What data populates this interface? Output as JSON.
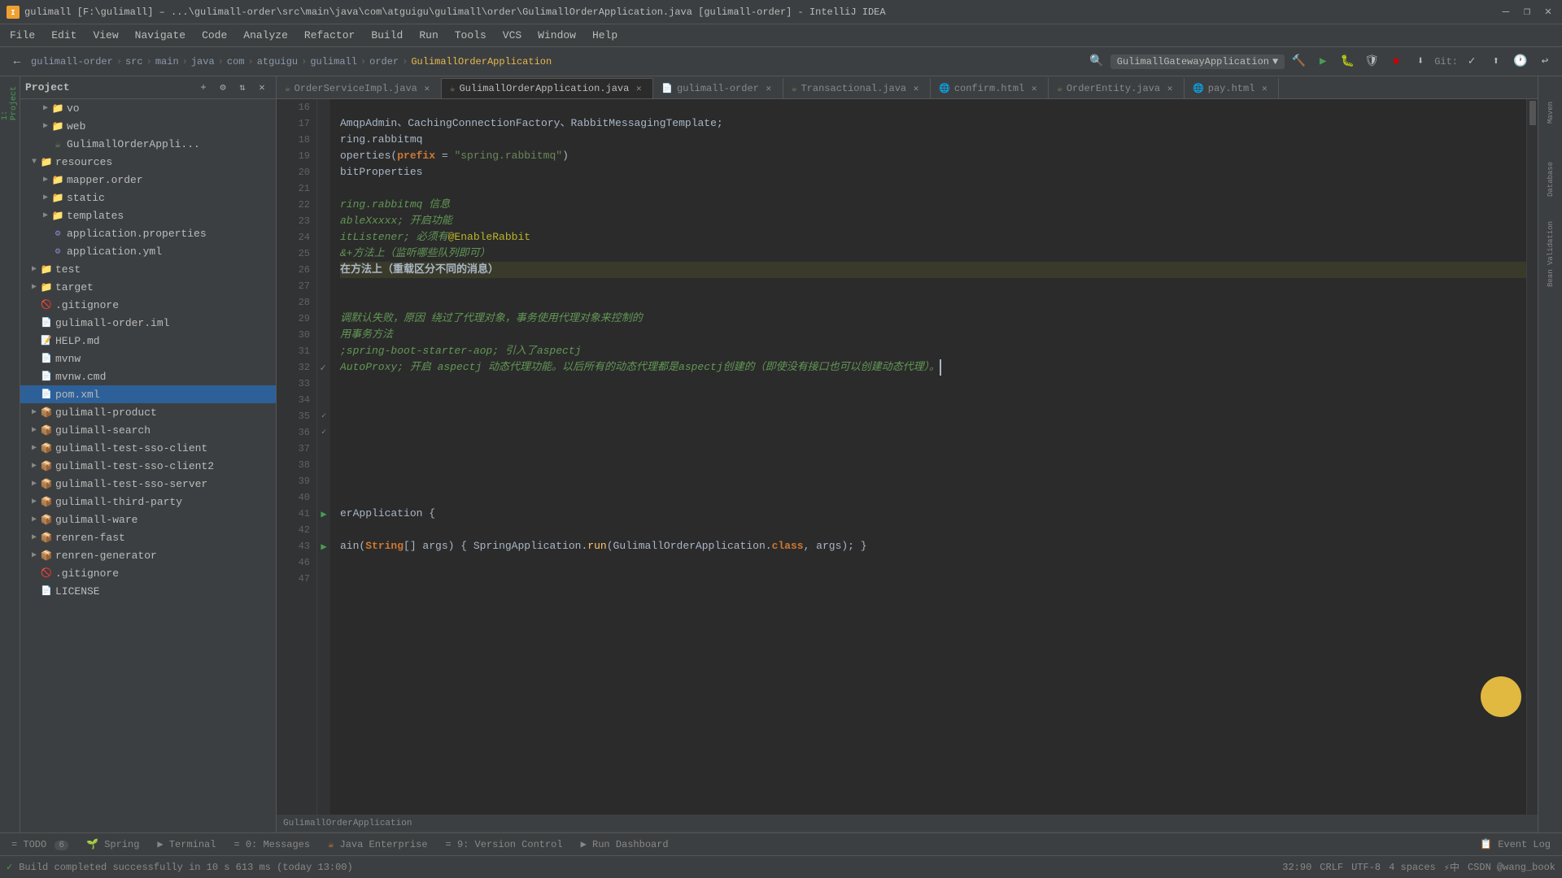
{
  "titleBar": {
    "title": "gulimall [F:\\gulimall] – ...\\gulimall-order\\src\\main\\java\\com\\atguigu\\gulimall\\order\\GulimallOrderApplication.java [gulimall-order] - IntelliJ IDEA",
    "minimize": "—",
    "maximize": "❐",
    "close": "✕"
  },
  "menuBar": {
    "items": [
      "File",
      "Edit",
      "View",
      "Navigate",
      "Code",
      "Analyze",
      "Refactor",
      "Build",
      "Run",
      "Tools",
      "VCS",
      "Window",
      "Help"
    ]
  },
  "toolbar": {
    "breadcrumb": [
      "gulimall-order",
      "src",
      "main",
      "java",
      "com",
      "atguigu",
      "gulimall",
      "order",
      "GulimallOrderApplication"
    ],
    "runConfig": "GulimallGatewayApplication",
    "gitLabel": "Git:"
  },
  "tabs": [
    {
      "name": "OrderServiceImpl.java",
      "type": "java",
      "active": false,
      "modified": false
    },
    {
      "name": "GulimallOrderApplication.java",
      "type": "java",
      "active": true,
      "modified": false
    },
    {
      "name": "gulimall-order",
      "type": "xml",
      "active": false,
      "modified": false
    },
    {
      "name": "Transactional.java",
      "type": "java",
      "active": false,
      "modified": false
    },
    {
      "name": "confirm.html",
      "type": "html",
      "active": false,
      "modified": false
    },
    {
      "name": "OrderEntity.java",
      "type": "java",
      "active": false,
      "modified": false
    },
    {
      "name": "pay.html",
      "type": "html",
      "active": false,
      "modified": false
    }
  ],
  "codeLines": [
    {
      "num": 16,
      "content": "",
      "markers": []
    },
    {
      "num": 17,
      "content": "AmqpAdmin、CachingConnectionFactory、RabbitMessagingTemplate;",
      "markers": []
    },
    {
      "num": 18,
      "content": "ring.rabbitmq",
      "markers": []
    },
    {
      "num": 19,
      "content": "operties(prefix = \"spring.rabbitmq\")",
      "markers": []
    },
    {
      "num": 20,
      "content": "bitProperties",
      "markers": []
    },
    {
      "num": 21,
      "content": "",
      "markers": []
    },
    {
      "num": 22,
      "content": "ring.rabbitmq 信息",
      "markers": []
    },
    {
      "num": 23,
      "content": "ableXxxxx; 开启功能",
      "markers": []
    },
    {
      "num": 24,
      "content": "itListener; 必须有@EnableRabbit",
      "markers": []
    },
    {
      "num": 25,
      "content": "&+方法上（监听哪些队列即可）",
      "markers": []
    },
    {
      "num": 26,
      "content": "在方法上（重载区分不同的消息）",
      "markers": [
        "highlight"
      ]
    },
    {
      "num": 27,
      "content": "",
      "markers": []
    },
    {
      "num": 28,
      "content": "",
      "markers": []
    },
    {
      "num": 29,
      "content": "调默认失败，原因 绕过了代理对象，事务使用代理对象来控制的",
      "markers": []
    },
    {
      "num": 30,
      "content": "用事务方法",
      "markers": []
    },
    {
      "num": 31,
      "content": ";spring-boot-starter-aop; 引入了aspectj",
      "markers": []
    },
    {
      "num": 32,
      "content": "AutoProxy; 开启 aspectj 动态代理功能。以后所有的动态代理都是aspectj创建的（即使没有接口也可以创建动态代理）。",
      "markers": [
        "cursor"
      ]
    },
    {
      "num": 33,
      "content": "",
      "markers": []
    },
    {
      "num": 34,
      "content": "",
      "markers": []
    },
    {
      "num": 35,
      "content": "",
      "markers": []
    },
    {
      "num": 36,
      "content": "",
      "markers": []
    },
    {
      "num": 37,
      "content": "",
      "markers": []
    },
    {
      "num": 38,
      "content": "",
      "markers": []
    },
    {
      "num": 39,
      "content": "",
      "markers": []
    },
    {
      "num": 40,
      "content": "",
      "markers": []
    },
    {
      "num": 41,
      "content": "erApplication {",
      "markers": []
    },
    {
      "num": 42,
      "content": "",
      "markers": []
    },
    {
      "num": 43,
      "content": "ain(String[] args) { SpringApplication.run(GulimallOrderApplication.class, args); }",
      "markers": []
    },
    {
      "num": 46,
      "content": "",
      "markers": []
    },
    {
      "num": 47,
      "content": "",
      "markers": []
    }
  ],
  "sidebar": {
    "projectLabel": "Project",
    "tree": [
      {
        "level": 1,
        "type": "folder",
        "label": "vo",
        "expanded": false
      },
      {
        "level": 1,
        "type": "folder",
        "label": "web",
        "expanded": false
      },
      {
        "level": 1,
        "type": "java",
        "label": "GulimallOrderAppli..."
      },
      {
        "level": 0,
        "type": "folder",
        "label": "resources",
        "expanded": true
      },
      {
        "level": 1,
        "type": "folder",
        "label": "mapper.order",
        "expanded": false
      },
      {
        "level": 1,
        "type": "folder",
        "label": "static",
        "expanded": false
      },
      {
        "level": 1,
        "type": "folder",
        "label": "templates",
        "expanded": false
      },
      {
        "level": 1,
        "type": "properties",
        "label": "application.properties"
      },
      {
        "level": 1,
        "type": "yml",
        "label": "application.yml"
      },
      {
        "level": 0,
        "type": "folder",
        "label": "test",
        "expanded": false
      },
      {
        "level": 0,
        "type": "folder",
        "label": "target",
        "expanded": false
      },
      {
        "level": 0,
        "type": "gitignore",
        "label": ".gitignore"
      },
      {
        "level": 0,
        "type": "iml",
        "label": "gulimall-order.iml"
      },
      {
        "level": 0,
        "type": "md",
        "label": "HELP.md"
      },
      {
        "level": 0,
        "type": "mvn",
        "label": "mvnw"
      },
      {
        "level": 0,
        "type": "cmd",
        "label": "mvnw.cmd"
      },
      {
        "level": 0,
        "type": "xml",
        "label": "pom.xml"
      },
      {
        "level": 0,
        "type": "module",
        "label": "gulimall-product",
        "expanded": false
      },
      {
        "level": 0,
        "type": "module",
        "label": "gulimall-search",
        "expanded": false
      },
      {
        "level": 0,
        "type": "module",
        "label": "gulimall-test-sso-client",
        "expanded": false
      },
      {
        "level": 0,
        "type": "module",
        "label": "gulimall-test-sso-client2",
        "expanded": false
      },
      {
        "level": 0,
        "type": "module",
        "label": "gulimall-test-sso-server",
        "expanded": false
      },
      {
        "level": 0,
        "type": "module",
        "label": "gulimall-third-party",
        "expanded": false
      },
      {
        "level": 0,
        "type": "module",
        "label": "gulimall-ware",
        "expanded": false
      },
      {
        "level": 0,
        "type": "module",
        "label": "renren-fast",
        "expanded": false
      },
      {
        "level": 0,
        "type": "module",
        "label": "renren-generator",
        "expanded": false
      },
      {
        "level": 0,
        "type": "gitignore2",
        "label": ".gitignore"
      },
      {
        "level": 0,
        "type": "md2",
        "label": "LICENSE"
      }
    ]
  },
  "bottomTabs": [
    {
      "label": "TODO",
      "num": "6",
      "icon": "=",
      "active": false
    },
    {
      "label": "Spring",
      "icon": "🌱",
      "active": false
    },
    {
      "label": "Terminal",
      "icon": "▶",
      "active": false
    },
    {
      "label": "Messages",
      "num": "0:",
      "icon": "=",
      "active": false
    },
    {
      "label": "Java Enterprise",
      "icon": "☕",
      "active": false
    },
    {
      "label": "Version Control",
      "num": "9:",
      "icon": "=",
      "active": false
    },
    {
      "label": "Run Dashboard",
      "icon": "▶",
      "active": false
    },
    {
      "label": "Event Log",
      "icon": "",
      "active": false
    }
  ],
  "statusBar": {
    "buildStatus": "Build completed successfully in 10 s 613 ms (today 13:00)",
    "position": "32:90",
    "lineEnding": "CRLF",
    "encoding": "UTF-8",
    "indent": "4 spaces",
    "powerSave": "⚡中",
    "user": "CSDN @wang_book"
  },
  "fileBreadcrumb": "GulimallOrderApplication",
  "rightPanelLabels": [
    "Maven",
    "Database",
    "Bean Validation"
  ],
  "leftPanelLabel": "1: Project"
}
